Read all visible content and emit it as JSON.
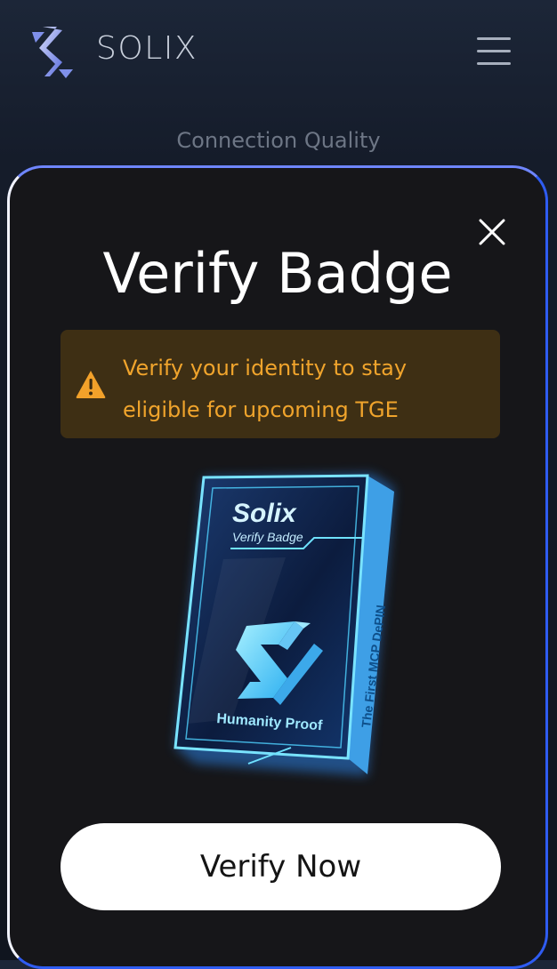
{
  "header": {
    "logo_text": "SOLIX",
    "menu_icon": "hamburger-menu-icon"
  },
  "section_label": "Connection Quality",
  "modal": {
    "title": "Verify Badge",
    "close_icon": "close-icon",
    "warning": {
      "icon": "warning-triangle-icon",
      "text": "Verify your identity to stay eligible for upcoming TGE"
    },
    "badge": {
      "brand": "Solix",
      "subtitle": "Verify Badge",
      "side_text": "The First MCP DePIN",
      "footer_text": "Humanity Proof"
    },
    "button_label": "Verify Now"
  },
  "colors": {
    "warning_text": "#f0a42c",
    "warning_bg": "#3e2f14",
    "modal_bg": "#161619",
    "modal_border": "#2f5cf2",
    "badge_cyan": "#53d3ff"
  }
}
